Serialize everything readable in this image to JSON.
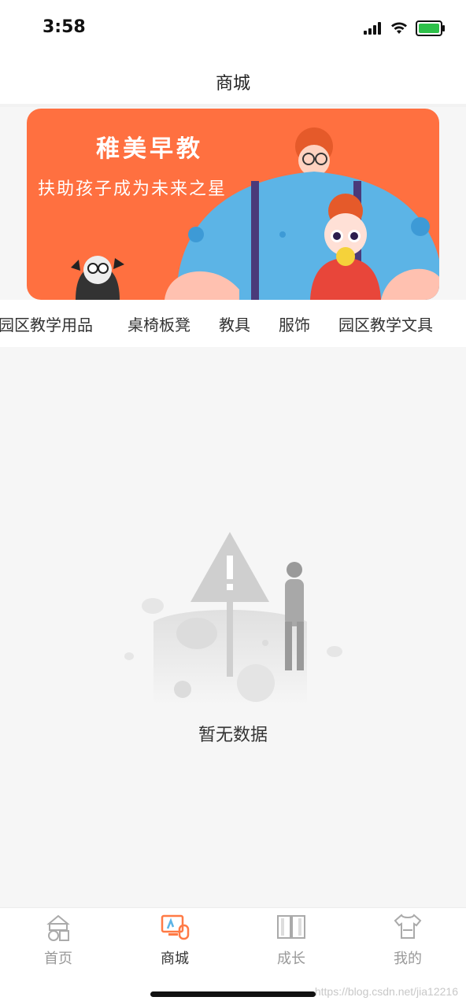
{
  "status_bar": {
    "time": "3:58"
  },
  "navbar": {
    "title": "商城"
  },
  "banner": {
    "title": "稚美早教",
    "subtitle": "扶助孩子成为未来之星"
  },
  "category_tabs": [
    {
      "label": "园区教学用品",
      "active": false
    },
    {
      "label": "桌椅板凳",
      "active": false
    },
    {
      "label": "教具",
      "active": false
    },
    {
      "label": "服饰",
      "active": false
    },
    {
      "label": "园区教学文具",
      "active": true
    }
  ],
  "empty_state": {
    "text": "暂无数据"
  },
  "tabbar": {
    "items": [
      {
        "label": "首页",
        "icon": "home-icon",
        "active": false
      },
      {
        "label": "商城",
        "icon": "shop-icon",
        "active": true
      },
      {
        "label": "成长",
        "icon": "book-icon",
        "active": false
      },
      {
        "label": "我的",
        "icon": "profile-icon",
        "active": false
      }
    ]
  },
  "watermark": "https://blog.csdn.net/jia12216",
  "colors": {
    "accent": "#ff7a45",
    "banner_bg": "#ff7040"
  }
}
